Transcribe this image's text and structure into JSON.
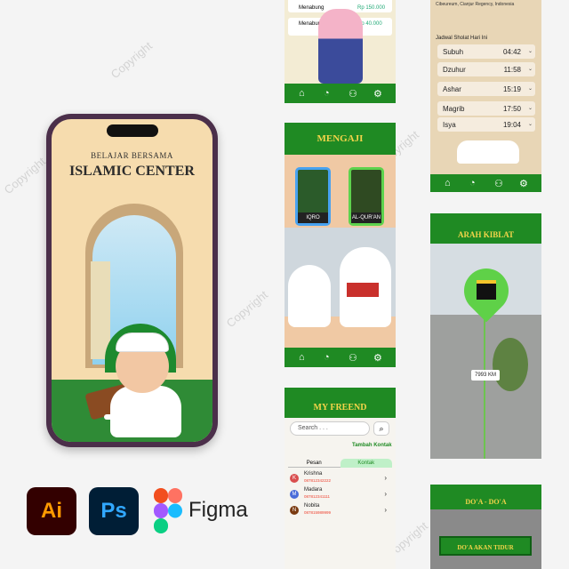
{
  "phone": {
    "subtitle": "BELAJAR BERSAMA",
    "title": "ISLAMIC CENTER"
  },
  "tools": {
    "ai": "Ai",
    "ps": "Ps",
    "figma": "Figma"
  },
  "watermark": "Copyright",
  "screen_money": {
    "rows": [
      {
        "label": "Menabung",
        "amount": "Rp 150.000"
      },
      {
        "label": "Menabung",
        "amount": "Rp 40.000"
      }
    ]
  },
  "screen_mengaji": {
    "title": "MENGAJI",
    "cards": [
      "IQRO",
      "AL-QUR'AN"
    ]
  },
  "screen_friend": {
    "title": "MY FREEND",
    "search_placeholder": "Search . . .",
    "add_contact": "Tambah Kontak",
    "tabs": [
      "Pesan",
      "Kontak"
    ],
    "contacts": [
      {
        "initial": "K",
        "name": "Krishna",
        "number": "087812342222",
        "color": "#d94e4e"
      },
      {
        "initial": "M",
        "name": "Madara",
        "number": "087812341111",
        "color": "#4a6cd9"
      },
      {
        "initial": "N",
        "name": "Nobita",
        "number": "087815989999",
        "color": "#7a3a10"
      }
    ]
  },
  "screen_jadwal": {
    "location": "Cibeureum, Cianjur Regency, Indonesia",
    "title": "Jadwal Sholat Hari Ini",
    "prayers": [
      {
        "name": "Subuh",
        "time": "04:42"
      },
      {
        "name": "Dzuhur",
        "time": "11:58"
      },
      {
        "name": "Ashar",
        "time": "15:19"
      },
      {
        "name": "Magrib",
        "time": "17:50"
      },
      {
        "name": "Isya",
        "time": "19:04"
      }
    ]
  },
  "screen_kiblat": {
    "title": "ARAH KIBLAT",
    "distance": "7993 KM"
  },
  "screen_doa": {
    "title": "DO'A - DO'A",
    "button": "DO'A AKAN TIDUR"
  },
  "nav_icons": [
    "home-icon",
    "chart-icon",
    "users-icon",
    "gear-icon"
  ]
}
